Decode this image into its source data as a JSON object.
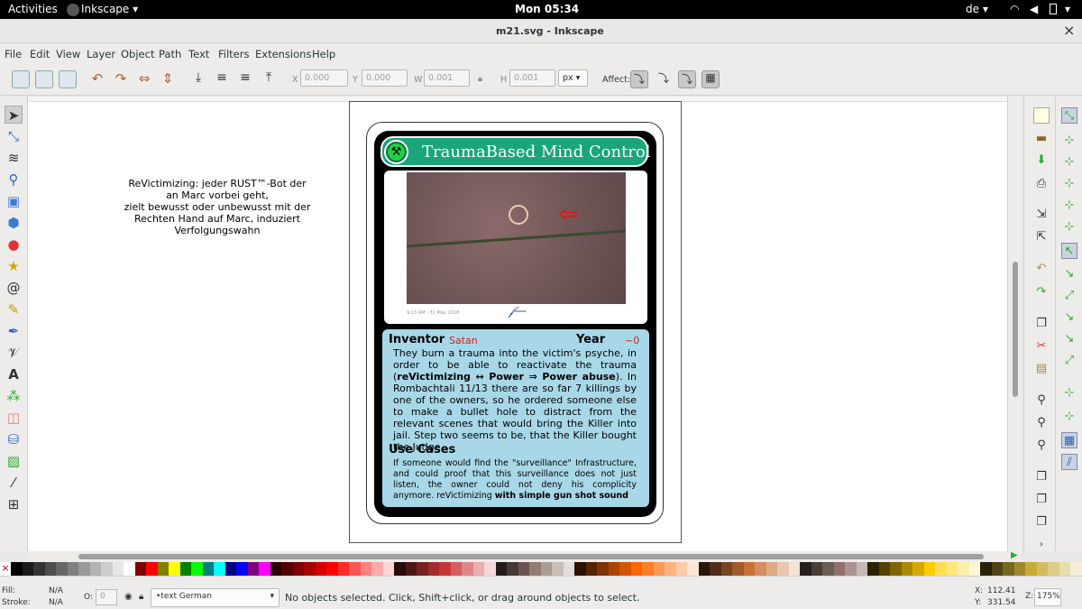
{
  "topbar": {
    "activities": "Activities",
    "app": "Inkscape ▾",
    "clock": "Mon 05:34",
    "lang": "de ▾"
  },
  "window": {
    "title": "m21.svg - Inkscape",
    "close": "×"
  },
  "menu": [
    "File",
    "Edit",
    "View",
    "Layer",
    "Object",
    "Path",
    "Text",
    "Filters",
    "Extensions",
    "Help"
  ],
  "toolbar": {
    "x_label": "X",
    "x_value": "0.000",
    "y_label": "Y",
    "y_value": "0.000",
    "w_label": "W",
    "w_value": "0.001",
    "h_label": "H",
    "h_value": "0.001",
    "unit": "px",
    "affect_label": "Affect:"
  },
  "canvas_text": {
    "line1": "ReVictimizing: jeder RUST™-Bot der",
    "line2": "an Marc vorbei geht,",
    "line3": "zielt bewusst oder unbewusst mit der",
    "line4": "Rechten Hand auf Marc, induziert Verfolgungswahn"
  },
  "card": {
    "title": "TraumaBased Mind Control",
    "photo_caption": "9:13 AM - 31 May 2018",
    "inventor_label": "Inventor",
    "inventor_value": "Satan",
    "year_label": "Year",
    "year_value": "~0",
    "body_1": "They burn a trauma into the victim's psyche, in order to be able to reactivate the trauma (",
    "body_bold": "reVictimizing ↔ Power ⇒ Power abuse",
    "body_2": "). In Rombachtali 11/13 there are so far 7 killings by one of the owners, so he ordered someone else to make a bullet hole to distract from the relevant scenes that would bring the Killer into jail. Step two seems to be, that the Killer bought the Judge.",
    "use_cases_label": "Use Cases",
    "use_1": "If someone would find the \"surveillance\" Infrastructure, and could proof that this surveillance does not just listen, the owner could not deny his complicity anymore. reVictimizing ",
    "use_bold": "with simple gun shot sound"
  },
  "status": {
    "fill_label": "Fill:",
    "fill_value": "N/A",
    "stroke_label": "Stroke:",
    "stroke_value": "N/A",
    "o_label": "O:",
    "o_value": "0",
    "layer": "•text German",
    "message": "No objects selected. Click, Shift+click, or drag around objects to select.",
    "x_label": "X:",
    "x_value": "112.41",
    "y_label": "Y:",
    "y_value": "331.54",
    "z_label": "Z:",
    "zoom": "175%"
  },
  "colors": {
    "card_green": "#1aa57a",
    "card_blue": "#a8d8e8",
    "red": "#d62020"
  },
  "palette": [
    "#000000",
    "#1a1a1a",
    "#333333",
    "#4d4d4d",
    "#666666",
    "#808080",
    "#999999",
    "#b3b3b3",
    "#cccccc",
    "#e6e6e6",
    "#ffffff",
    "#800000",
    "#ff0000",
    "#808000",
    "#ffff00",
    "#008000",
    "#00ff00",
    "#008080",
    "#00ffff",
    "#000080",
    "#0000ff",
    "#800080",
    "#ff00ff",
    "#2b0000",
    "#550000",
    "#800000",
    "#aa0000",
    "#d40000",
    "#ff0000",
    "#ff2a2a",
    "#ff5555",
    "#ff8080",
    "#ffaaaa",
    "#ffd5d5",
    "#280b0b",
    "#501616",
    "#782121",
    "#a02c2c",
    "#c83737",
    "#d35f5f",
    "#de8787",
    "#e9afaf",
    "#f4d7d7",
    "#241c1c",
    "#483737",
    "#6c5353",
    "#917c6f",
    "#ac9d93",
    "#c8beb7",
    "#e3dedb",
    "#2b1100",
    "#552200",
    "#803300",
    "#aa4400",
    "#d45500",
    "#ff6600",
    "#ff7f2a",
    "#ff9955",
    "#ffb380",
    "#ffccaa",
    "#ffe6d5",
    "#28170b",
    "#502d16",
    "#784421",
    "#a05a2c",
    "#c87137",
    "#d38d5f",
    "#deaa87",
    "#e9c6af",
    "#f4e3d7",
    "#241f1c",
    "#483e37",
    "#6c5d53",
    "#916f6f",
    "#ac9393",
    "#c8b7b7",
    "#2b2200",
    "#554400",
    "#806600",
    "#aa8800",
    "#d4aa00",
    "#ffcc00",
    "#ffdd55",
    "#ffe680",
    "#ffeeaa",
    "#fff6d5",
    "#28220b",
    "#504416",
    "#786721",
    "#a0892c",
    "#c8ab37",
    "#d3bc5f",
    "#decd87",
    "#e9ddaf",
    "#f4eed7"
  ]
}
